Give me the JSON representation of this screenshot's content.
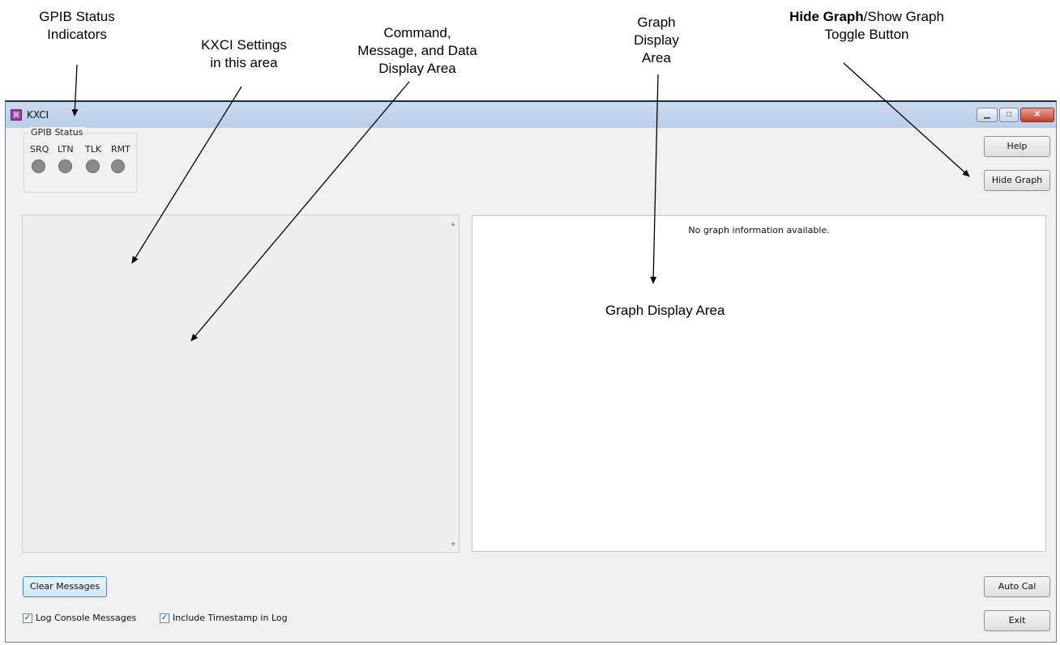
{
  "callouts": {
    "gpib_line1": "GPIB Status",
    "gpib_line2": "Indicators",
    "kxci_line1": "KXCI Settings",
    "kxci_line2": "in this area",
    "cmd_line1": "Command,",
    "cmd_line2": "Message, and Data",
    "cmd_line3": "Display Area",
    "graph_line1": "Graph",
    "graph_line2": "Display",
    "graph_line3": "Area",
    "hide_bold": "Hide Graph",
    "hide_rest": "/Show Graph",
    "hide_line2": "Toggle Button",
    "graph_area_overlay": "Graph Display Area"
  },
  "window": {
    "title": "KXCI",
    "icon": "kxci-app-icon",
    "controls": {
      "minimize": "▁",
      "maximize": "□",
      "close": "✕"
    }
  },
  "gpib_status": {
    "title": "GPIB Status",
    "indicators": [
      "SRQ",
      "LTN",
      "TLK",
      "RMT"
    ],
    "led_color": "#8a8a8a"
  },
  "buttons": {
    "help": "Help",
    "hide_graph": "Hide Graph",
    "auto_cal": "Auto Cal",
    "exit": "Exit",
    "clear_messages": "Clear Messages"
  },
  "graph": {
    "empty_message": "No graph information available."
  },
  "checkboxes": {
    "log_console": {
      "label": "Log Console Messages",
      "checked": true
    },
    "timestamp": {
      "label": "Include Timestamp in Log",
      "checked": true
    }
  }
}
